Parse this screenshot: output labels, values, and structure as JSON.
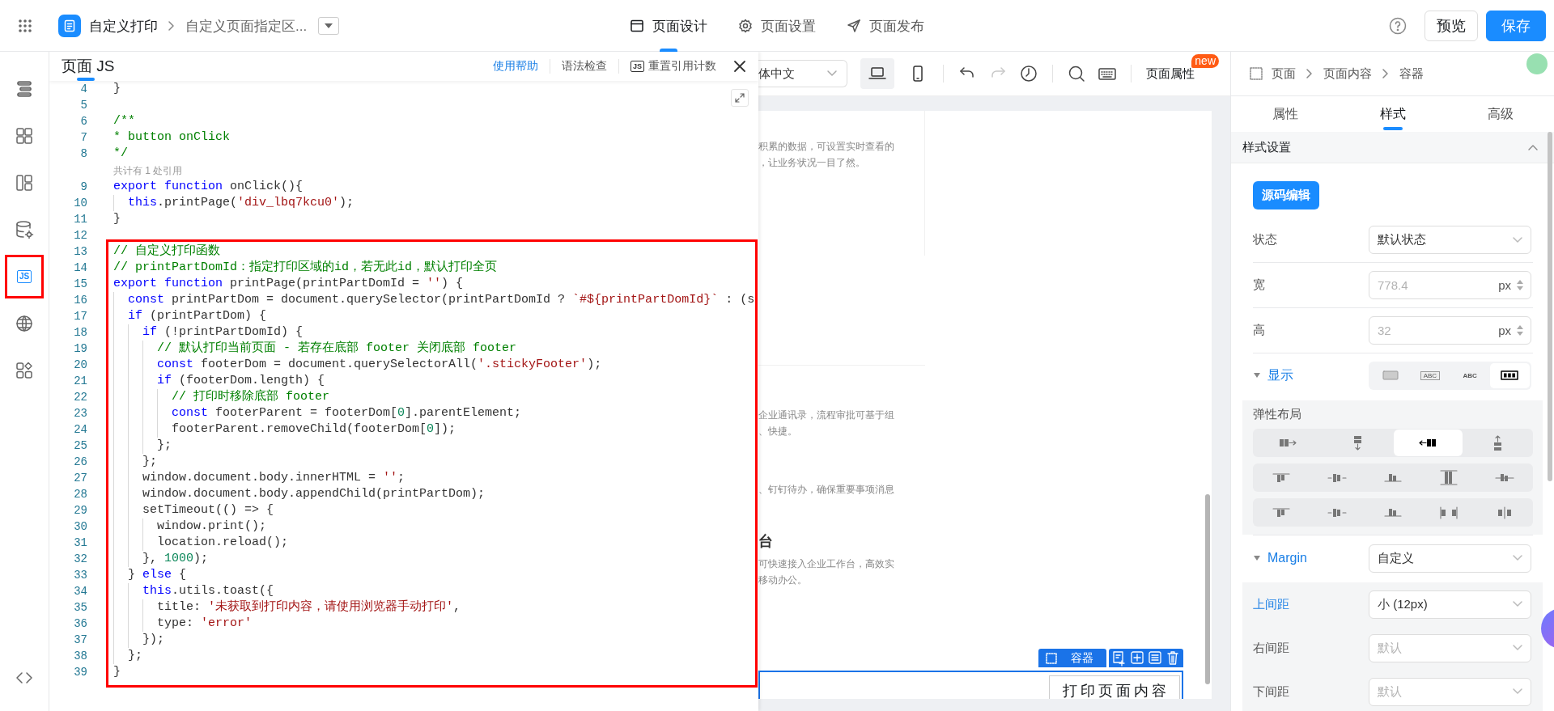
{
  "topbar": {
    "app_title": "自定义打印",
    "page_title": "自定义页面指定区...",
    "tabs": [
      {
        "kind": "design",
        "label": "页面设计",
        "selected": true
      },
      {
        "kind": "settings",
        "label": "页面设置",
        "selected": false
      },
      {
        "kind": "publish",
        "label": "页面发布",
        "selected": false
      }
    ],
    "buttons": [
      {
        "kind": "secondary",
        "label": "预览"
      },
      {
        "kind": "primary",
        "label": "保存"
      }
    ]
  },
  "rail": {
    "items": [
      {
        "kind": "outline",
        "selected": false,
        "annotated": false
      },
      {
        "kind": "components",
        "selected": false,
        "annotated": false
      },
      {
        "kind": "layout",
        "selected": false,
        "annotated": false
      },
      {
        "kind": "data",
        "selected": false,
        "annotated": false
      },
      {
        "kind": "js",
        "label": "JS",
        "selected": true,
        "annotated": true
      },
      {
        "kind": "globe",
        "selected": false,
        "annotated": false
      },
      {
        "kind": "plugins",
        "selected": false,
        "annotated": false
      }
    ],
    "bottom": {
      "kind": "code"
    }
  },
  "js_panel": {
    "title": "页面 JS",
    "actions": [
      {
        "kind": "link",
        "label": "使用帮助"
      },
      {
        "kind": "plain",
        "label": "语法检查"
      },
      {
        "kind": "icon",
        "icon_label": "JS",
        "label": "重置引用计数"
      }
    ],
    "blocks": [
      {
        "annotated": false,
        "lines": [
          {
            "kind": "code",
            "num": "4",
            "tokens": [
              {
                "kind": "plain",
                "text": "}"
              }
            ]
          },
          {
            "kind": "code",
            "num": "5"
          },
          {
            "kind": "code",
            "num": "6",
            "tokens": [
              {
                "kind": "comment",
                "text": "/**"
              }
            ]
          },
          {
            "kind": "code",
            "num": "7",
            "tokens": [
              {
                "kind": "comment",
                "text": "* button onClick"
              }
            ]
          },
          {
            "kind": "code",
            "num": "8",
            "tokens": [
              {
                "kind": "comment",
                "text": "*/"
              }
            ]
          },
          {
            "kind": "lens",
            "text": "共计有 1 处引用"
          },
          {
            "kind": "code",
            "num": "9",
            "tokens": [
              {
                "kind": "keyword",
                "text": "export "
              },
              {
                "kind": "keyword",
                "text": "function"
              },
              {
                "kind": "plain",
                "text": " onClick(){"
              }
            ]
          },
          {
            "kind": "code",
            "num": "10",
            "tokens": [
              {
                "kind": "keyword",
                "text": "  this"
              },
              {
                "kind": "plain",
                "text": ".printPage("
              },
              {
                "kind": "string",
                "text": "'div_lbq7kcu0'"
              },
              {
                "kind": "plain",
                "text": ");"
              }
            ]
          },
          {
            "kind": "code",
            "num": "11",
            "tokens": [
              {
                "kind": "plain",
                "text": "}"
              }
            ]
          },
          {
            "kind": "code",
            "num": "12"
          }
        ]
      },
      {
        "annotated": true,
        "lines": [
          {
            "kind": "code",
            "num": "13",
            "tokens": [
              {
                "kind": "comment",
                "text": "// 自定义打印函数"
              }
            ]
          },
          {
            "kind": "code",
            "num": "14",
            "tokens": [
              {
                "kind": "comment",
                "text": "// printPartDomId：指定打印区域的id，若无此id，默认打印全页"
              }
            ]
          },
          {
            "kind": "code",
            "num": "15",
            "tokens": [
              {
                "kind": "keyword",
                "text": "export "
              },
              {
                "kind": "keyword",
                "text": "function"
              },
              {
                "kind": "plain",
                "text": " printPage(printPartDomId = "
              },
              {
                "kind": "string",
                "text": "''"
              },
              {
                "kind": "plain",
                "text": ") {"
              }
            ]
          },
          {
            "kind": "code",
            "num": "16",
            "tokens": [
              {
                "kind": "keyword",
                "text": "  const"
              },
              {
                "kind": "plain",
                "text": " printPartDom = document.querySelector(printPartDomId ? "
              },
              {
                "kind": "string",
                "text": "`#${printPartDomId}`"
              },
              {
                "kind": "plain",
                "text": " : (s"
              }
            ]
          },
          {
            "kind": "code",
            "num": "17",
            "tokens": [
              {
                "kind": "keyword",
                "text": "  if"
              },
              {
                "kind": "plain",
                "text": " (printPartDom) {"
              }
            ]
          },
          {
            "kind": "code",
            "num": "18",
            "tokens": [
              {
                "kind": "keyword",
                "text": "    if"
              },
              {
                "kind": "plain",
                "text": " (!printPartDomId) {"
              }
            ]
          },
          {
            "kind": "code",
            "num": "19",
            "tokens": [
              {
                "kind": "comment",
                "text": "      // 默认打印当前页面 - 若存在底部 footer 关闭底部 footer"
              }
            ]
          },
          {
            "kind": "code",
            "num": "20",
            "tokens": [
              {
                "kind": "keyword",
                "text": "      const"
              },
              {
                "kind": "plain",
                "text": " footerDom = document.querySelectorAll("
              },
              {
                "kind": "string",
                "text": "'.stickyFooter'"
              },
              {
                "kind": "plain",
                "text": ");"
              }
            ]
          },
          {
            "kind": "code",
            "num": "21",
            "tokens": [
              {
                "kind": "keyword",
                "text": "      if"
              },
              {
                "kind": "plain",
                "text": " (footerDom.length) {"
              }
            ]
          },
          {
            "kind": "code",
            "num": "22",
            "tokens": [
              {
                "kind": "comment",
                "text": "        // 打印时移除底部 footer"
              }
            ]
          },
          {
            "kind": "code",
            "num": "23",
            "tokens": [
              {
                "kind": "keyword",
                "text": "        const"
              },
              {
                "kind": "plain",
                "text": " footerParent = footerDom["
              },
              {
                "kind": "number",
                "text": "0"
              },
              {
                "kind": "plain",
                "text": "].parentElement;"
              }
            ]
          },
          {
            "kind": "code",
            "num": "24",
            "tokens": [
              {
                "kind": "plain",
                "text": "        footerParent.removeChild(footerDom["
              },
              {
                "kind": "number",
                "text": "0"
              },
              {
                "kind": "plain",
                "text": "]);"
              }
            ]
          },
          {
            "kind": "code",
            "num": "25",
            "tokens": [
              {
                "kind": "plain",
                "text": "      };"
              }
            ]
          },
          {
            "kind": "code",
            "num": "26",
            "tokens": [
              {
                "kind": "plain",
                "text": "    };"
              }
            ]
          },
          {
            "kind": "code",
            "num": "27",
            "tokens": [
              {
                "kind": "plain",
                "text": "    window.document.body.innerHTML = "
              },
              {
                "kind": "string",
                "text": "''"
              },
              {
                "kind": "plain",
                "text": ";"
              }
            ]
          },
          {
            "kind": "code",
            "num": "28",
            "tokens": [
              {
                "kind": "plain",
                "text": "    window.document.body.appendChild(printPartDom);"
              }
            ]
          },
          {
            "kind": "code",
            "num": "29",
            "tokens": [
              {
                "kind": "plain",
                "text": "    setTimeout(() => {"
              }
            ]
          },
          {
            "kind": "code",
            "num": "30",
            "tokens": [
              {
                "kind": "plain",
                "text": "      window.print();"
              }
            ]
          },
          {
            "kind": "code",
            "num": "31",
            "tokens": [
              {
                "kind": "plain",
                "text": "      location.reload();"
              }
            ]
          },
          {
            "kind": "code",
            "num": "32",
            "tokens": [
              {
                "kind": "plain",
                "text": "    }, "
              },
              {
                "kind": "number",
                "text": "1000"
              },
              {
                "kind": "plain",
                "text": ");"
              }
            ]
          },
          {
            "kind": "code",
            "num": "33",
            "tokens": [
              {
                "kind": "plain",
                "text": "  } "
              },
              {
                "kind": "keyword",
                "text": "else"
              },
              {
                "kind": "plain",
                "text": " {"
              }
            ]
          },
          {
            "kind": "code",
            "num": "34",
            "tokens": [
              {
                "kind": "keyword",
                "text": "    this"
              },
              {
                "kind": "plain",
                "text": ".utils.toast({"
              }
            ]
          },
          {
            "kind": "code",
            "num": "35",
            "tokens": [
              {
                "kind": "plain",
                "text": "      title: "
              },
              {
                "kind": "string",
                "text": "'未获取到打印内容，请使用浏览器手动打印'"
              },
              {
                "kind": "plain",
                "text": ","
              }
            ]
          },
          {
            "kind": "code",
            "num": "36",
            "tokens": [
              {
                "kind": "plain",
                "text": "      type: "
              },
              {
                "kind": "string",
                "text": "'error'"
              }
            ]
          },
          {
            "kind": "code",
            "num": "37",
            "tokens": [
              {
                "kind": "plain",
                "text": "    });"
              }
            ]
          },
          {
            "kind": "code",
            "num": "38",
            "tokens": [
              {
                "kind": "plain",
                "text": "  };"
              }
            ]
          },
          {
            "kind": "code",
            "num": "39",
            "tokens": [
              {
                "kind": "plain",
                "text": "}"
              }
            ]
          }
        ]
      }
    ]
  },
  "canvas": {
    "language": "体中文",
    "devices": [
      {
        "kind": "desktop",
        "selected": true
      },
      {
        "kind": "mobile",
        "selected": false
      }
    ],
    "tools": [
      {
        "kind": "undo",
        "disabled": false
      },
      {
        "kind": "redo",
        "disabled": true
      },
      {
        "kind": "history",
        "disabled": false
      },
      {
        "kind": "search",
        "disabled": false
      },
      {
        "kind": "keyboard",
        "disabled": false
      }
    ],
    "page_properties": {
      "label": "页面属性",
      "badge": "new"
    },
    "sections": [
      {
        "lines": [
          {
            "kind": "text",
            "text": "积累的数据，可设置实时查看的"
          },
          {
            "kind": "text",
            "text": "，让业务状况一目了然。"
          }
        ]
      },
      {
        "lines": [
          {
            "kind": "text",
            "text": "企业通讯录，流程审批可基于组"
          },
          {
            "kind": "text",
            "text": "、快捷。"
          }
        ]
      },
      {
        "lines": [
          {
            "kind": "text",
            "text": "、钉钉待办，确保重要事项消息"
          }
        ]
      },
      {
        "lines": [
          {
            "kind": "heading",
            "text": "台"
          },
          {
            "kind": "text",
            "text": "可快速接入企业工作台，高效实"
          },
          {
            "kind": "text",
            "text": "移动办公。"
          }
        ]
      }
    ],
    "selection": {
      "label": "容器",
      "actions": [
        {
          "kind": "edit"
        },
        {
          "kind": "add"
        },
        {
          "kind": "copy"
        },
        {
          "kind": "delete"
        }
      ]
    },
    "print_button": "打印页面内容"
  },
  "properties": {
    "breadcrumb": [
      {
        "label": "页面"
      },
      {
        "label": "页面内容"
      },
      {
        "label": "容器"
      }
    ],
    "tabs": [
      {
        "label": "属性",
        "selected": false
      },
      {
        "label": "样式",
        "selected": true
      },
      {
        "label": "高级",
        "selected": false
      }
    ],
    "section": {
      "title": "样式设置",
      "expanded": true
    },
    "source_button": "源码编辑",
    "fields": [
      {
        "kind": "select",
        "label": "状态",
        "value": "默认状态"
      },
      {
        "kind": "number",
        "label": "宽",
        "placeholder": "778.4",
        "unit": "px"
      },
      {
        "kind": "number",
        "label": "高",
        "placeholder": "32",
        "unit": "px"
      }
    ],
    "display": {
      "label": "显示",
      "expanded": true,
      "options": [
        {
          "kind": "block",
          "selected": false
        },
        {
          "kind": "inline-block",
          "label": "ABC",
          "selected": false
        },
        {
          "kind": "inline",
          "label": "ABC",
          "selected": false
        },
        {
          "kind": "flex",
          "selected": true
        }
      ]
    },
    "flex": {
      "title": "弹性布局",
      "direction": [
        {
          "kind": "row",
          "selected": false
        },
        {
          "kind": "column",
          "selected": false
        },
        {
          "kind": "row-reverse",
          "selected": true
        },
        {
          "kind": "column-reverse",
          "selected": false
        }
      ],
      "align": [
        {
          "kind": "start",
          "selected": false
        },
        {
          "kind": "center",
          "selected": false
        },
        {
          "kind": "end",
          "selected": false
        },
        {
          "kind": "stretch",
          "selected": false
        },
        {
          "kind": "baseline",
          "selected": false
        }
      ],
      "justify": [
        {
          "kind": "start",
          "selected": false
        },
        {
          "kind": "center",
          "selected": false
        },
        {
          "kind": "end",
          "selected": false
        },
        {
          "kind": "between",
          "selected": false
        },
        {
          "kind": "around",
          "selected": false
        }
      ]
    },
    "margin": {
      "label": "Margin",
      "expanded": true,
      "value": "自定义",
      "fields": [
        {
          "label": "上间距",
          "value": "小 (12px)",
          "active": true
        },
        {
          "label": "右间距",
          "placeholder": "默认",
          "active": false
        },
        {
          "label": "下间距",
          "placeholder": "默认",
          "active": false
        }
      ]
    }
  }
}
